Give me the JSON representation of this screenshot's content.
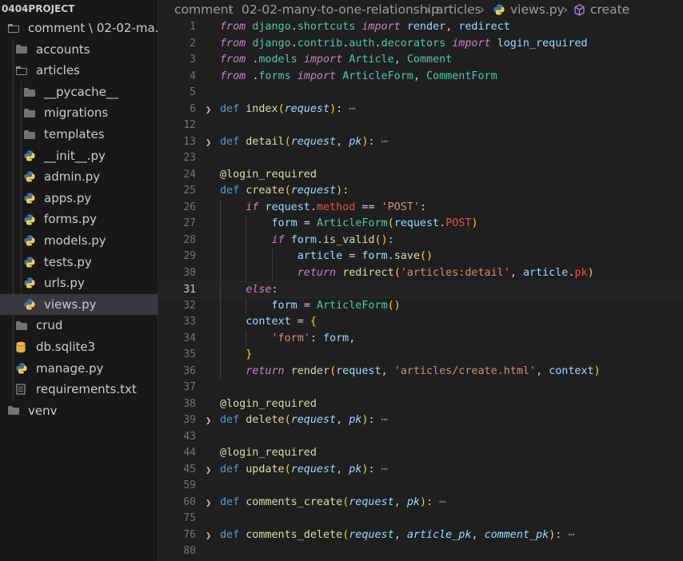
{
  "explorer": {
    "project": "0404PROJECT",
    "items": [
      {
        "label": "comment \\ 02-02-ma...",
        "type": "folder-open",
        "depth": 0
      },
      {
        "label": "accounts",
        "type": "folder",
        "depth": 1
      },
      {
        "label": "articles",
        "type": "folder-open",
        "depth": 1
      },
      {
        "label": "__pycache__",
        "type": "folder",
        "depth": 2
      },
      {
        "label": "migrations",
        "type": "folder",
        "depth": 2
      },
      {
        "label": "templates",
        "type": "folder",
        "depth": 2
      },
      {
        "label": "__init__.py",
        "type": "python",
        "depth": 2
      },
      {
        "label": "admin.py",
        "type": "python",
        "depth": 2
      },
      {
        "label": "apps.py",
        "type": "python",
        "depth": 2
      },
      {
        "label": "forms.py",
        "type": "python",
        "depth": 2
      },
      {
        "label": "models.py",
        "type": "python",
        "depth": 2
      },
      {
        "label": "tests.py",
        "type": "python",
        "depth": 2
      },
      {
        "label": "urls.py",
        "type": "python",
        "depth": 2
      },
      {
        "label": "views.py",
        "type": "python",
        "depth": 2,
        "selected": true
      },
      {
        "label": "crud",
        "type": "folder",
        "depth": 1
      },
      {
        "label": "db.sqlite3",
        "type": "database",
        "depth": 1
      },
      {
        "label": "manage.py",
        "type": "python",
        "depth": 1
      },
      {
        "label": "requirements.txt",
        "type": "text",
        "depth": 1
      },
      {
        "label": "venv",
        "type": "folder",
        "depth": 0
      }
    ]
  },
  "breadcrumb": [
    "comment",
    "02-02-many-to-one-relationship",
    "articles",
    "views.py",
    "create"
  ],
  "breadcrumb_icons": {
    "file": "python-icon",
    "symbol": "method-cube-icon"
  },
  "editor": {
    "current_line": "31",
    "lines": [
      {
        "n": "1",
        "t": "from django.shortcuts import render, redirect"
      },
      {
        "n": "2",
        "t": "from django.contrib.auth.decorators import login_required"
      },
      {
        "n": "3",
        "t": "from .models import Article, Comment"
      },
      {
        "n": "4",
        "t": "from .forms import ArticleForm, CommentForm"
      },
      {
        "n": "5",
        "t": ""
      },
      {
        "n": "6",
        "t": "def index(request): ...",
        "folded": true
      },
      {
        "n": "12",
        "t": ""
      },
      {
        "n": "13",
        "t": "def detail(request, pk): ...",
        "folded": true
      },
      {
        "n": "23",
        "t": ""
      },
      {
        "n": "24",
        "t": "@login_required"
      },
      {
        "n": "25",
        "t": "def create(request):"
      },
      {
        "n": "26",
        "t": "    if request.method == 'POST':"
      },
      {
        "n": "27",
        "t": "        form = ArticleForm(request.POST)"
      },
      {
        "n": "28",
        "t": "        if form.is_valid():"
      },
      {
        "n": "29",
        "t": "            article = form.save()"
      },
      {
        "n": "30",
        "t": "            return redirect('articles:detail', article.pk)"
      },
      {
        "n": "31",
        "t": "    else:"
      },
      {
        "n": "32",
        "t": "        form = ArticleForm()"
      },
      {
        "n": "33",
        "t": "    context = {"
      },
      {
        "n": "34",
        "t": "        'form': form,"
      },
      {
        "n": "35",
        "t": "    }"
      },
      {
        "n": "36",
        "t": "    return render(request, 'articles/create.html', context)"
      },
      {
        "n": "37",
        "t": ""
      },
      {
        "n": "38",
        "t": "@login_required"
      },
      {
        "n": "39",
        "t": "def delete(request, pk): ...",
        "folded": true
      },
      {
        "n": "43",
        "t": ""
      },
      {
        "n": "44",
        "t": "@login_required"
      },
      {
        "n": "45",
        "t": "def update(request, pk): ...",
        "folded": true
      },
      {
        "n": "59",
        "t": ""
      },
      {
        "n": "60",
        "t": "def comments_create(request, pk): ...",
        "folded": true
      },
      {
        "n": "75",
        "t": ""
      },
      {
        "n": "76",
        "t": "def comments_delete(request, article_pk, comment_pk): ...",
        "folded": true
      },
      {
        "n": "80",
        "t": ""
      }
    ]
  },
  "colors": {
    "background": "#1f1f1f",
    "sidebar": "#181818",
    "selection": "#37373d",
    "keyword_blue": "#569cd6",
    "keyword_purple": "#c586c0",
    "function": "#dcdcaa",
    "class": "#4ec9b0",
    "string": "#ce9178",
    "variable": "#9cdcfe"
  }
}
